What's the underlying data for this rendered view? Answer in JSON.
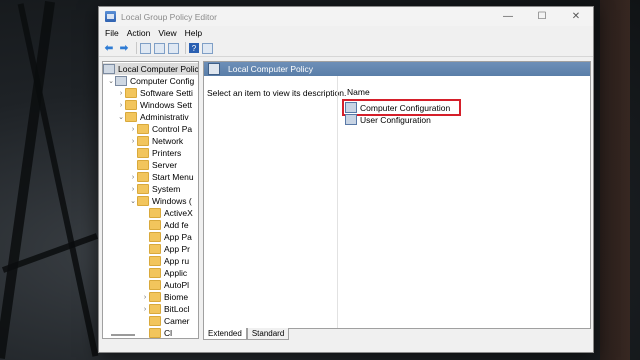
{
  "window": {
    "title": "Local Group Policy Editor",
    "controls": {
      "minimize": "—",
      "maximize": "☐",
      "close": "✕"
    }
  },
  "menubar": [
    "File",
    "Action",
    "View",
    "Help"
  ],
  "toolbar": {
    "icons": [
      "back-arrow",
      "forward-arrow",
      "show-hide-console-tree",
      "properties",
      "export-list",
      "help",
      "filter-view"
    ],
    "help_glyph": "?"
  },
  "tree": {
    "root": "Local Computer Polic",
    "computer_config": "Computer Config",
    "software_settings": "Software Setti",
    "windows_settings": "Windows Sett",
    "administrative": "Administrativ",
    "control_panel": "Control Pa",
    "network": "Network",
    "printers": "Printers",
    "server": "Server",
    "start_menu": "Start Menu",
    "system": "System",
    "windows_components": "Windows (",
    "children": [
      "ActiveX",
      "Add fe",
      "App Pa",
      "App Pr",
      "App ru",
      "Applic",
      "AutoPl",
      "Biome",
      "BitLocl",
      "Camer",
      "Cl"
    ]
  },
  "right": {
    "header": "Local Computer Policy",
    "description": "Select an item to view its description.",
    "column_name": "Name",
    "items": [
      "Computer Configuration",
      "User Configuration"
    ]
  },
  "tabs": [
    "Extended",
    "Standard"
  ],
  "colors": {
    "highlight": "#d51f2a",
    "header": "#5a7ea8"
  }
}
